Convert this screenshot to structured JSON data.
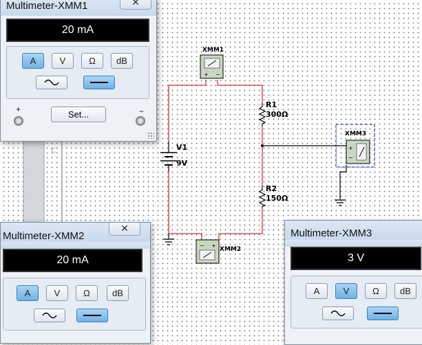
{
  "circuit": {
    "v1": {
      "label": "V1",
      "value": "9V"
    },
    "r1": {
      "label": "R1",
      "value": "300Ω"
    },
    "r2": {
      "label": "R2",
      "value": "150Ω"
    },
    "xmm1_label": "XMM1",
    "xmm2_label": "XMM2",
    "xmm3_label": "XMM3",
    "faint_label": "C"
  },
  "windows": [
    {
      "title": "Multimeter-XMM1",
      "close": "✕",
      "reading": "20 mA",
      "buttons": [
        "A",
        "V",
        "Ω",
        "dB"
      ],
      "active": "A",
      "wave_active": "dc",
      "set_label": "Set...",
      "plus": "+",
      "minus": "−"
    },
    {
      "title": "Multimeter-XMM2",
      "close": "✕",
      "reading": "20 mA",
      "buttons": [
        "A",
        "V",
        "Ω",
        "dB"
      ],
      "active": "A",
      "wave_active": "dc"
    },
    {
      "title": "Multimeter-XMM3",
      "reading": "3 V",
      "buttons": [
        "A",
        "V",
        "Ω",
        "dB"
      ],
      "active": "V",
      "wave_active": "dc"
    }
  ],
  "colors": {
    "wire_red": "#e03030",
    "wire_black": "#000000",
    "selection": "#2a3fd0",
    "active_button": "#7cbcea"
  }
}
